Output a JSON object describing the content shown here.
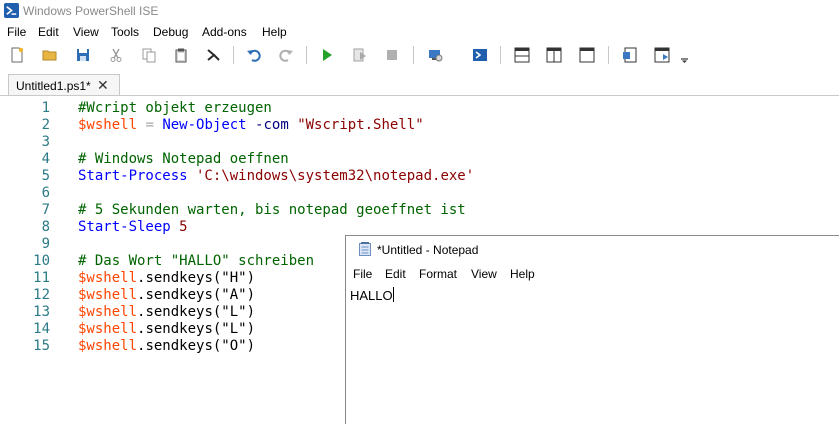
{
  "window": {
    "title": "Windows PowerShell ISE"
  },
  "menu": {
    "items": [
      "File",
      "Edit",
      "View",
      "Tools",
      "Debug",
      "Add-ons",
      "Help"
    ]
  },
  "toolbar": {
    "buttons": [
      "new-script",
      "open",
      "save",
      "cut",
      "copy",
      "paste",
      "clear-console",
      "undo",
      "redo",
      "run-script",
      "run-selection",
      "stop",
      "new-remote-tab",
      "start-powershell",
      "show-script-top",
      "show-script-right",
      "show-script-maximized",
      "show-command-window",
      "show-command-addon",
      "toolbar-overflow"
    ]
  },
  "tabs": [
    {
      "label": "Untitled1.ps1*",
      "close": "✕"
    }
  ],
  "editor": {
    "lines": [
      {
        "num": "1",
        "tokens": [
          {
            "t": "#Wcript objekt erzeugen",
            "c": "com"
          }
        ]
      },
      {
        "num": "2",
        "tokens": [
          {
            "t": "$wshell",
            "c": "var"
          },
          {
            "t": " = ",
            "c": "op"
          },
          {
            "t": "New-Object",
            "c": "cmd"
          },
          {
            "t": " -com",
            "c": "par"
          },
          {
            "t": " \"Wscript.Shell\"",
            "c": "str"
          }
        ]
      },
      {
        "num": "3",
        "tokens": []
      },
      {
        "num": "4",
        "tokens": [
          {
            "t": "# Windows Notepad oeffnen",
            "c": "com"
          }
        ]
      },
      {
        "num": "5",
        "tokens": [
          {
            "t": "Start-Process",
            "c": "cmd"
          },
          {
            "t": " 'C:\\windows\\system32\\notepad.exe'",
            "c": "str"
          }
        ]
      },
      {
        "num": "6",
        "tokens": []
      },
      {
        "num": "7",
        "tokens": [
          {
            "t": "# 5 Sekunden warten, bis notepad geoeffnet ist",
            "c": "com"
          }
        ]
      },
      {
        "num": "8",
        "tokens": [
          {
            "t": "Start-Sleep",
            "c": "cmd"
          },
          {
            "t": " 5",
            "c": "str"
          }
        ]
      },
      {
        "num": "9",
        "tokens": []
      },
      {
        "num": "10",
        "tokens": [
          {
            "t": "# Das Wort \"HALLO\" schreiben",
            "c": "com"
          }
        ]
      },
      {
        "num": "11",
        "tokens": [
          {
            "t": "$wshell",
            "c": "var"
          },
          {
            "t": ".sendkeys",
            "c": "mem"
          },
          {
            "t": "(\"H\")",
            "c": "def"
          }
        ]
      },
      {
        "num": "12",
        "tokens": [
          {
            "t": "$wshell",
            "c": "var"
          },
          {
            "t": ".sendkeys",
            "c": "mem"
          },
          {
            "t": "(\"A\")",
            "c": "def"
          }
        ]
      },
      {
        "num": "13",
        "tokens": [
          {
            "t": "$wshell",
            "c": "var"
          },
          {
            "t": ".sendkeys",
            "c": "mem"
          },
          {
            "t": "(\"L\")",
            "c": "def"
          }
        ]
      },
      {
        "num": "14",
        "tokens": [
          {
            "t": "$wshell",
            "c": "var"
          },
          {
            "t": ".sendkeys",
            "c": "mem"
          },
          {
            "t": "(\"L\")",
            "c": "def"
          }
        ]
      },
      {
        "num": "15",
        "tokens": [
          {
            "t": "$wshell",
            "c": "var"
          },
          {
            "t": ".sendkeys",
            "c": "mem"
          },
          {
            "t": "(\"O\")",
            "c": "def"
          }
        ]
      }
    ]
  },
  "notepad": {
    "title": "*Untitled - Notepad",
    "menu": [
      "File",
      "Edit",
      "Format",
      "View",
      "Help"
    ],
    "content": "HALLO"
  },
  "colors": {
    "comment": "#006400",
    "variable": "#ff4500",
    "operator": "#a9a9a9",
    "command": "#0000ff",
    "parameter": "#000080",
    "string": "#8b0000",
    "line_number": "#2b7a87"
  }
}
